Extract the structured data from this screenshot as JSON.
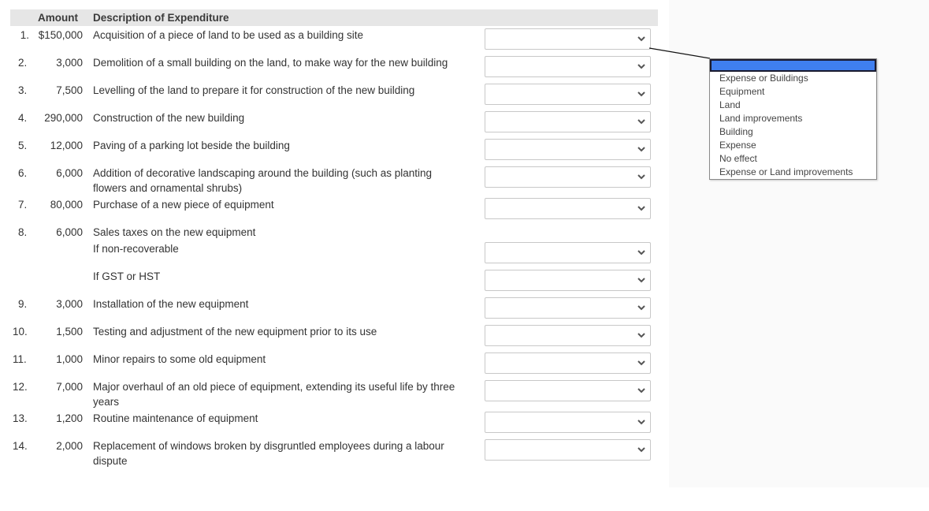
{
  "header": {
    "amount_label": "Amount",
    "description_label": "Description of Expenditure"
  },
  "rows": [
    {
      "num": "1.",
      "amount": "$150,000",
      "description": "Acquisition of a piece of land to be used as a building site"
    },
    {
      "num": "2.",
      "amount": "3,000",
      "description": "Demolition of a small building on the land, to make way for the new building"
    },
    {
      "num": "3.",
      "amount": "7,500",
      "description": "Levelling of the land to prepare it for construction of the new building"
    },
    {
      "num": "4.",
      "amount": "290,000",
      "description": "Construction of the new building"
    },
    {
      "num": "5.",
      "amount": "12,000",
      "description": "Paving of a parking lot beside the building"
    },
    {
      "num": "6.",
      "amount": "6,000",
      "description": "Addition of decorative landscaping around the building (such as planting flowers and ornamental shrubs)"
    },
    {
      "num": "7.",
      "amount": "80,000",
      "description": "Purchase of a new piece of equipment"
    },
    {
      "num": "8.",
      "amount": "6,000",
      "description": "Sales taxes on the new equipment",
      "sub_a": "If non-recoverable",
      "sub_b": "If GST or HST"
    },
    {
      "num": "9.",
      "amount": "3,000",
      "description": "Installation of the new equipment"
    },
    {
      "num": "10.",
      "amount": "1,500",
      "description": "Testing and adjustment of the new equipment prior to its use"
    },
    {
      "num": "11.",
      "amount": "1,000",
      "description": "Minor repairs to some old equipment"
    },
    {
      "num": "12.",
      "amount": "7,000",
      "description": "Major overhaul of an old piece of equipment, extending its useful life by three years"
    },
    {
      "num": "13.",
      "amount": "1,200",
      "description": "Routine maintenance of equipment"
    },
    {
      "num": "14.",
      "amount": "2,000",
      "description": "Replacement of windows broken by disgruntled employees during a labour dispute"
    }
  ],
  "selects": {
    "current_value": "",
    "options": [
      "",
      "Expense or Buildings",
      "Equipment",
      "Land",
      "Land improvements",
      "Building",
      "Expense",
      "No effect",
      "Expense or Land improvements"
    ]
  },
  "dropdown": {
    "highlight_color": "#3f7ff0",
    "options": [
      "Expense or Buildings",
      "Equipment",
      "Land",
      "Land improvements",
      "Building",
      "Expense",
      "No effect",
      "Expense or Land improvements"
    ]
  }
}
